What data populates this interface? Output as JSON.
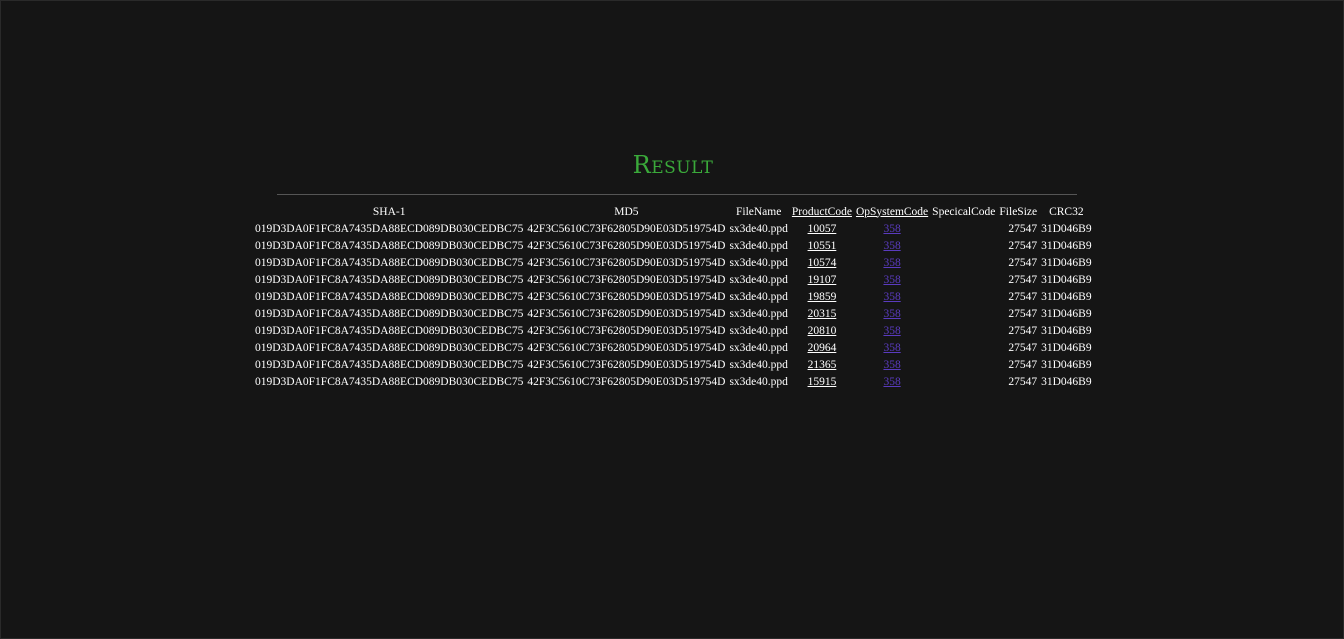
{
  "page": {
    "title": "Result"
  },
  "table": {
    "headers": {
      "sha1": "SHA-1",
      "md5": "MD5",
      "filename": "FileName",
      "productcode": "ProductCode",
      "opsystemcode": "OpSystemCode",
      "specialcode": "SpecicalCode",
      "filesize": "FileSize",
      "crc32": "CRC32"
    },
    "rows": [
      {
        "sha1": "019D3DA0F1FC8A7435DA88ECD089DB030CEDBC75",
        "md5": "42F3C5610C73F62805D90E03D519754D",
        "filename": "sx3de40.ppd",
        "productcode": "10057",
        "opsystemcode": "358",
        "specialcode": "",
        "filesize": "27547",
        "crc32": "31D046B9"
      },
      {
        "sha1": "019D3DA0F1FC8A7435DA88ECD089DB030CEDBC75",
        "md5": "42F3C5610C73F62805D90E03D519754D",
        "filename": "sx3de40.ppd",
        "productcode": "10551",
        "opsystemcode": "358",
        "specialcode": "",
        "filesize": "27547",
        "crc32": "31D046B9"
      },
      {
        "sha1": "019D3DA0F1FC8A7435DA88ECD089DB030CEDBC75",
        "md5": "42F3C5610C73F62805D90E03D519754D",
        "filename": "sx3de40.ppd",
        "productcode": "10574",
        "opsystemcode": "358",
        "specialcode": "",
        "filesize": "27547",
        "crc32": "31D046B9"
      },
      {
        "sha1": "019D3DA0F1FC8A7435DA88ECD089DB030CEDBC75",
        "md5": "42F3C5610C73F62805D90E03D519754D",
        "filename": "sx3de40.ppd",
        "productcode": "19107",
        "opsystemcode": "358",
        "specialcode": "",
        "filesize": "27547",
        "crc32": "31D046B9"
      },
      {
        "sha1": "019D3DA0F1FC8A7435DA88ECD089DB030CEDBC75",
        "md5": "42F3C5610C73F62805D90E03D519754D",
        "filename": "sx3de40.ppd",
        "productcode": "19859",
        "opsystemcode": "358",
        "specialcode": "",
        "filesize": "27547",
        "crc32": "31D046B9"
      },
      {
        "sha1": "019D3DA0F1FC8A7435DA88ECD089DB030CEDBC75",
        "md5": "42F3C5610C73F62805D90E03D519754D",
        "filename": "sx3de40.ppd",
        "productcode": "20315",
        "opsystemcode": "358",
        "specialcode": "",
        "filesize": "27547",
        "crc32": "31D046B9"
      },
      {
        "sha1": "019D3DA0F1FC8A7435DA88ECD089DB030CEDBC75",
        "md5": "42F3C5610C73F62805D90E03D519754D",
        "filename": "sx3de40.ppd",
        "productcode": "20810",
        "opsystemcode": "358",
        "specialcode": "",
        "filesize": "27547",
        "crc32": "31D046B9"
      },
      {
        "sha1": "019D3DA0F1FC8A7435DA88ECD089DB030CEDBC75",
        "md5": "42F3C5610C73F62805D90E03D519754D",
        "filename": "sx3de40.ppd",
        "productcode": "20964",
        "opsystemcode": "358",
        "specialcode": "",
        "filesize": "27547",
        "crc32": "31D046B9"
      },
      {
        "sha1": "019D3DA0F1FC8A7435DA88ECD089DB030CEDBC75",
        "md5": "42F3C5610C73F62805D90E03D519754D",
        "filename": "sx3de40.ppd",
        "productcode": "21365",
        "opsystemcode": "358",
        "specialcode": "",
        "filesize": "27547",
        "crc32": "31D046B9"
      },
      {
        "sha1": "019D3DA0F1FC8A7435DA88ECD089DB030CEDBC75",
        "md5": "42F3C5610C73F62805D90E03D519754D",
        "filename": "sx3de40.ppd",
        "productcode": "15915",
        "opsystemcode": "358",
        "specialcode": "",
        "filesize": "27547",
        "crc32": "31D046B9"
      }
    ]
  },
  "colors": {
    "background": "#151515",
    "title": "#3aa93a",
    "text": "#ffffff",
    "visited_link": "#5a3bbf",
    "rule": "#555555"
  }
}
